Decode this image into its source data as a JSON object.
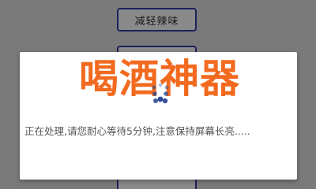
{
  "background": {
    "buttons": [
      {
        "label": "减轻辣味"
      },
      {
        "label": ""
      },
      {
        "label": ""
      }
    ]
  },
  "dialog": {
    "watermark": "喝酒神器",
    "message": "正在处理,请您耐心等待5分钟,注意保持屏幕长亮.....",
    "spinner_icon": "loading-spinner-icon"
  },
  "colors": {
    "watermark": "#f26a1f",
    "spinner": "#1f3f8f",
    "button_border": "#1d1f5c",
    "message_text": "#555555"
  }
}
